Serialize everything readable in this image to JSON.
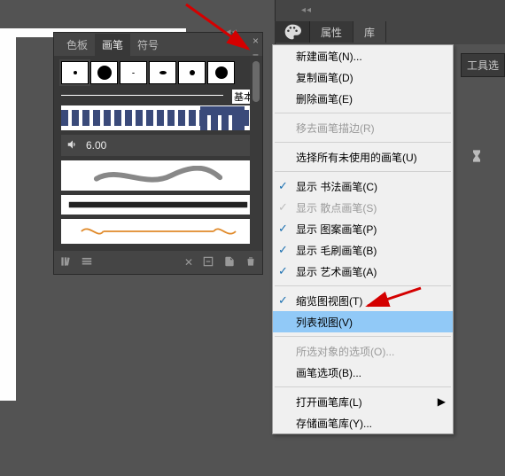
{
  "top_tabs": {
    "attrs": "属性",
    "library": "库"
  },
  "tool_button": "工具选",
  "panel": {
    "tabs": {
      "swatches": "色板",
      "brushes": "画笔",
      "symbols": "符号"
    },
    "basic_label": "基本",
    "audio_value": "6.00"
  },
  "menu": {
    "new_brush": "新建画笔(N)...",
    "duplicate": "复制画笔(D)",
    "delete": "删除画笔(E)",
    "remove_stroke": "移去画笔描边(R)",
    "select_unused": "选择所有未使用的画笔(U)",
    "show_calligraphic": "显示 书法画笔(C)",
    "show_scatter": "显示 散点画笔(S)",
    "show_pattern": "显示 图案画笔(P)",
    "show_bristle": "显示 毛刷画笔(B)",
    "show_art": "显示 艺术画笔(A)",
    "thumbnail_view": "缩览图视图(T)",
    "list_view": "列表视图(V)",
    "selected_options": "所选对象的选项(O)...",
    "brush_options": "画笔选项(B)...",
    "open_library": "打开画笔库(L)",
    "save_library": "存储画笔库(Y)..."
  }
}
